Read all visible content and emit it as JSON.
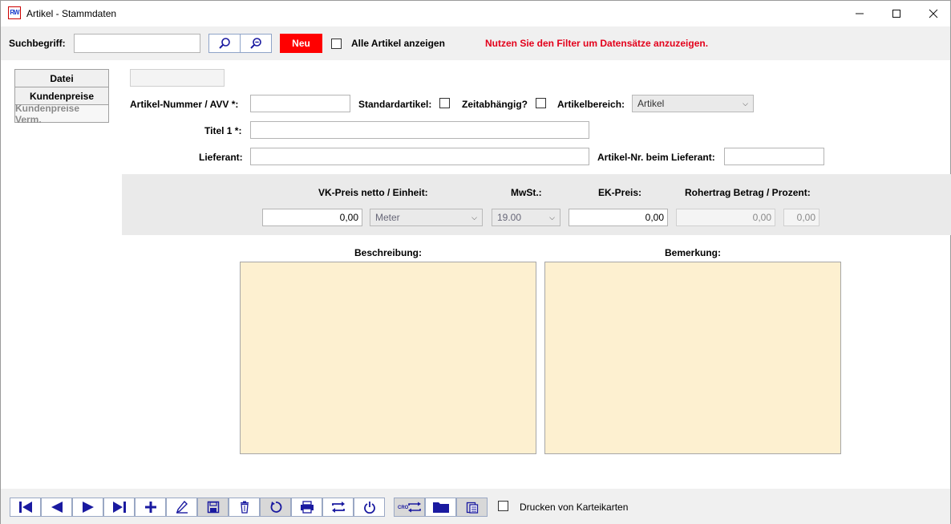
{
  "window": {
    "title": "Artikel - Stammdaten",
    "app_icon_text": "RW"
  },
  "search": {
    "label": "Suchbegriff:",
    "value": "",
    "new_button": "Neu",
    "show_all_label": "Alle Artikel anzeigen",
    "show_all_checked": false,
    "filter_message": "Nutzen Sie den Filter um Datensätze anzuzeigen."
  },
  "tabs": [
    {
      "label": "Datei",
      "enabled": true
    },
    {
      "label": "Kundenpreise",
      "enabled": true
    },
    {
      "label": "Kundenpreise Verm.",
      "enabled": false
    }
  ],
  "form": {
    "artikel_nummer_label": "Artikel-Nummer / AVV *:",
    "artikel_nummer_value": "",
    "standardartikel_label": "Standardartikel:",
    "zeitabhaengig_label": "Zeitabhängig?",
    "artikelbereich_label": "Artikelbereich:",
    "artikelbereich_value": "Artikel",
    "titel_label": "Titel 1 *:",
    "titel_value": "",
    "lieferant_label": "Lieferant:",
    "lieferant_value": "",
    "artikel_nr_lieferant_label": "Artikel-Nr. beim Lieferant:",
    "artikel_nr_lieferant_value": ""
  },
  "pricing": {
    "vk_label": "VK-Preis netto / Einheit:",
    "vk_value": "0,00",
    "einheit_value": "Meter",
    "mwst_label": "MwSt.:",
    "mwst_value": "19.00",
    "ek_label": "EK-Preis:",
    "ek_value": "0,00",
    "rohertrag_label": "Rohertrag Betrag / Prozent:",
    "rohertrag_betrag": "0,00",
    "rohertrag_prozent": "0,00"
  },
  "memo": {
    "beschreibung_label": "Beschreibung:",
    "bemerkung_label": "Bemerkung:"
  },
  "bottom": {
    "print_cards_label": "Drucken von Karteikarten",
    "print_cards_checked": false,
    "cro_icon_text": "CRO"
  }
}
